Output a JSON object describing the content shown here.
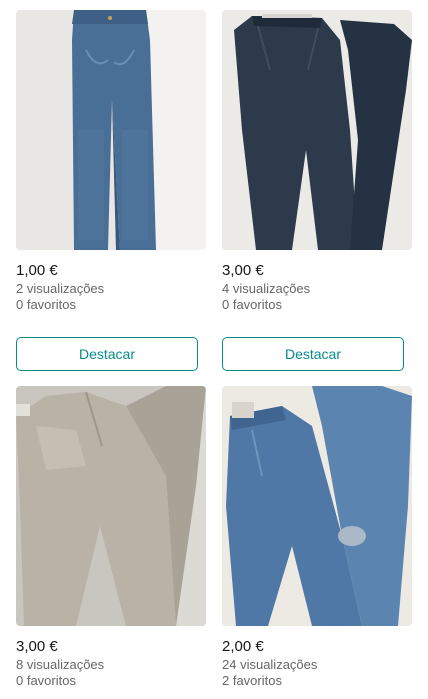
{
  "items": [
    {
      "price": "1,00 €",
      "views": "2 visualizações",
      "favorites": "0 favoritos",
      "bump_label": "Destacar",
      "photo": "skinny-blue-jeans"
    },
    {
      "price": "3,00 €",
      "views": "4 visualizações",
      "favorites": "0 favoritos",
      "bump_label": "Destacar",
      "photo": "dark-navy-trousers"
    },
    {
      "price": "3,00 €",
      "views": "8 visualizações",
      "favorites": "0 favoritos",
      "photo": "beige-chino-trousers"
    },
    {
      "price": "2,00 €",
      "views": "24 visualizações",
      "favorites": "2 favoritos",
      "photo": "ripped-blue-jeans"
    }
  ],
  "colors": {
    "accent": "#0a8a8a",
    "muted_text": "#666666"
  }
}
